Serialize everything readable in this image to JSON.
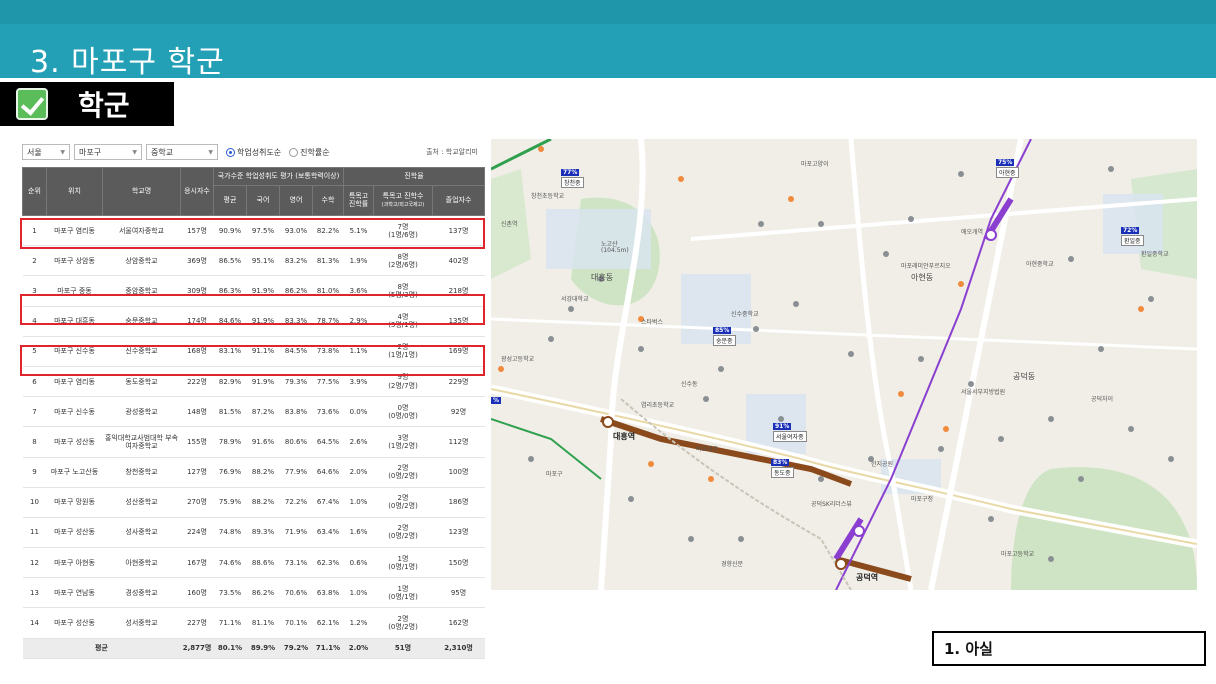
{
  "slide": {
    "title": "3. 마포구 학군",
    "section_label": "학군",
    "note": "1. 아실"
  },
  "filters": {
    "city": "서울",
    "district": "마포구",
    "school_type": "중학교",
    "radio_achievement": "학업성취도순",
    "radio_advance": "진학률순",
    "source": "출처 : 학교알리미"
  },
  "table": {
    "head": {
      "rank": "순위",
      "location": "위치",
      "school": "학교명",
      "takers": "응시자수",
      "group_eval": "국가수준 학업성취도 평가 (보통학력이상)",
      "avg": "평균",
      "korean": "국어",
      "english": "영어",
      "math": "수학",
      "group_adv": "진학율",
      "special_rate": "특목고 진학률",
      "special_count": "특목고 진학수",
      "special_sub": "(과학고/외고국제고)",
      "grads": "졸업자수"
    },
    "rows": [
      {
        "rank": "1",
        "loc": "마포구 염리동",
        "school": "서울여자중학교",
        "takers": "157명",
        "avg": "90.9%",
        "kor": "97.5%",
        "eng": "93.0%",
        "math": "82.2%",
        "rate": "5.1%",
        "count": "7명",
        "count_sub": "(1명/6명)",
        "grads": "137명"
      },
      {
        "rank": "2",
        "loc": "마포구 상암동",
        "school": "상암중학교",
        "takers": "369명",
        "avg": "86.5%",
        "kor": "95.1%",
        "eng": "83.2%",
        "math": "81.3%",
        "rate": "1.9%",
        "count": "8명",
        "count_sub": "(2명/6명)",
        "grads": "402명"
      },
      {
        "rank": "3",
        "loc": "마포구 중동",
        "school": "중암중학교",
        "takers": "309명",
        "avg": "86.3%",
        "kor": "91.9%",
        "eng": "86.2%",
        "math": "81.0%",
        "rate": "3.6%",
        "count": "8명",
        "count_sub": "(5명/3명)",
        "grads": "218명"
      },
      {
        "rank": "4",
        "loc": "마포구 대흥동",
        "school": "숭문중학교",
        "takers": "174명",
        "avg": "84.6%",
        "kor": "91.9%",
        "eng": "83.3%",
        "math": "78.7%",
        "rate": "2.9%",
        "count": "4명",
        "count_sub": "(3명/1명)",
        "grads": "135명"
      },
      {
        "rank": "5",
        "loc": "마포구 신수동",
        "school": "신수중학교",
        "takers": "168명",
        "avg": "83.1%",
        "kor": "91.1%",
        "eng": "84.5%",
        "math": "73.8%",
        "rate": "1.1%",
        "count": "2명",
        "count_sub": "(1명/1명)",
        "grads": "169명"
      },
      {
        "rank": "6",
        "loc": "마포구 염리동",
        "school": "동도중학교",
        "takers": "222명",
        "avg": "82.9%",
        "kor": "91.9%",
        "eng": "79.3%",
        "math": "77.5%",
        "rate": "3.9%",
        "count": "9명",
        "count_sub": "(2명/7명)",
        "grads": "229명"
      },
      {
        "rank": "7",
        "loc": "마포구 신수동",
        "school": "광성중학교",
        "takers": "148명",
        "avg": "81.5%",
        "kor": "87.2%",
        "eng": "83.8%",
        "math": "73.6%",
        "rate": "0.0%",
        "count": "0명",
        "count_sub": "(0명/0명)",
        "grads": "92명"
      },
      {
        "rank": "8",
        "loc": "마포구 성산동",
        "school": "홍익대학교사범대학 부속여자중학교",
        "takers": "155명",
        "avg": "78.9%",
        "kor": "91.6%",
        "eng": "80.6%",
        "math": "64.5%",
        "rate": "2.6%",
        "count": "3명",
        "count_sub": "(1명/2명)",
        "grads": "112명"
      },
      {
        "rank": "9",
        "loc": "마포구 노고산동",
        "school": "창천중학교",
        "takers": "127명",
        "avg": "76.9%",
        "kor": "88.2%",
        "eng": "77.9%",
        "math": "64.6%",
        "rate": "2.0%",
        "count": "2명",
        "count_sub": "(0명/2명)",
        "grads": "100명"
      },
      {
        "rank": "10",
        "loc": "마포구 망원동",
        "school": "성산중학교",
        "takers": "270명",
        "avg": "75.9%",
        "kor": "88.2%",
        "eng": "72.2%",
        "math": "67.4%",
        "rate": "1.0%",
        "count": "2명",
        "count_sub": "(0명/2명)",
        "grads": "186명"
      },
      {
        "rank": "11",
        "loc": "마포구 성산동",
        "school": "성사중학교",
        "takers": "224명",
        "avg": "74.8%",
        "kor": "89.3%",
        "eng": "71.9%",
        "math": "63.4%",
        "rate": "1.6%",
        "count": "2명",
        "count_sub": "(0명/2명)",
        "grads": "123명"
      },
      {
        "rank": "12",
        "loc": "마포구 아현동",
        "school": "아현중학교",
        "takers": "167명",
        "avg": "74.6%",
        "kor": "88.6%",
        "eng": "73.1%",
        "math": "62.3%",
        "rate": "0.6%",
        "count": "1명",
        "count_sub": "(0명/1명)",
        "grads": "150명"
      },
      {
        "rank": "13",
        "loc": "마포구 연남동",
        "school": "경성중학교",
        "takers": "160명",
        "avg": "73.5%",
        "kor": "86.2%",
        "eng": "70.6%",
        "math": "63.8%",
        "rate": "1.0%",
        "count": "1명",
        "count_sub": "(0명/1명)",
        "grads": "95명"
      },
      {
        "rank": "14",
        "loc": "마포구 성산동",
        "school": "성서중학교",
        "takers": "227명",
        "avg": "71.1%",
        "kor": "81.1%",
        "eng": "70.1%",
        "math": "62.1%",
        "rate": "1.2%",
        "count": "2명",
        "count_sub": "(0명/2명)",
        "grads": "162명"
      }
    ],
    "footer": {
      "label": "평균",
      "takers": "2,877명",
      "avg": "80.1%",
      "kor": "89.9%",
      "eng": "79.2%",
      "math": "71.1%",
      "rate": "2.0%",
      "count": "51명",
      "grads": "2,310명"
    }
  },
  "map": {
    "flags": [
      {
        "pct": "77%",
        "name": "창천중"
      },
      {
        "pct": "85%",
        "name": "숭문중"
      },
      {
        "pct": "91%",
        "name": "서울여자중"
      },
      {
        "pct": "83%",
        "name": "동도중"
      },
      {
        "pct": "75%",
        "name": "아현중"
      },
      {
        "pct": "72%",
        "name": "환일중"
      },
      {
        "pct": "%",
        "name": ""
      }
    ],
    "labels": {
      "daeheung_dong": "대흥동",
      "ahyeon_dong": "아현동",
      "gongdeok_dong": "공덕동",
      "mapo_goyangi": "마포고양이",
      "noksan": "노고산",
      "noksan_h": "(104.5m)",
      "daeheung_st": "대흥역",
      "gongdeok_st": "공덕역",
      "aeogae_st": "애오개역",
      "seogang_univ": "서강대학교",
      "sinchon_st": "신촌역",
      "mapo_road": "마포대로",
      "changcheon": "창천초등학교",
      "yeomni": "염리초등학교",
      "mapo_hs": "마포고등학교",
      "ahyeon_ms": "아현중학교",
      "hwanil_ms": "환일중학교",
      "starbucks": "스타벅스",
      "mapo_office": "마포구청",
      "sinsu_ms": "신수중학교",
      "gwangseong_hs": "광성고등학교",
      "mapo_ahyeon": "마포래미안푸르지오",
      "gongdeok_sk": "공덕SK리더스뷰",
      "gongdeok_ea": "공덕자이",
      "hanji": "한지공원",
      "seoul_west": "서울서부지방법원",
      "mapo_gu": "마포구",
      "seogyo": "신수동",
      "gyeonghyang": "경향신문"
    }
  }
}
